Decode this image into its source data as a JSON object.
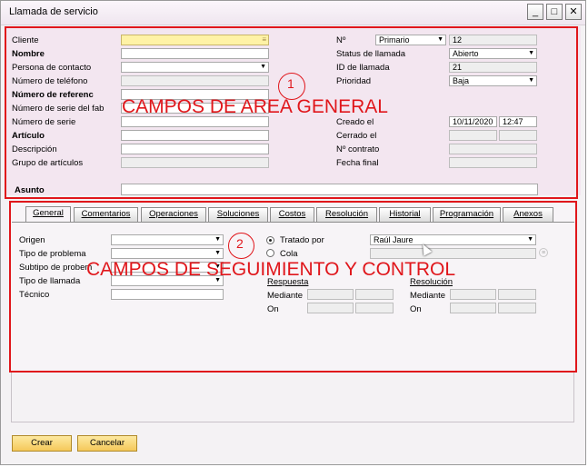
{
  "window": {
    "title": "Llamada de servicio",
    "minimize": "_",
    "maximize": "□",
    "close": "✕"
  },
  "general": {
    "left_labels": [
      "Cliente",
      "Nombre",
      "Persona de contacto",
      "Número de teléfono",
      "Número de referenc",
      "Número de serie del fab",
      "Número de serie",
      "Artículo",
      "Descripción",
      "Grupo de artículos"
    ],
    "right_labels": [
      "Nº",
      "Status de llamada",
      "ID de llamada",
      "Prioridad",
      "Creado el",
      "Cerrado el",
      "Nº contrato",
      "Fecha final"
    ],
    "numbering_series": "Primario",
    "number": "12",
    "status": "Abierto",
    "call_id": "21",
    "priority": "Baja",
    "created_date": "10/11/2020",
    "created_time": "12:47",
    "subject_label": "Asunto"
  },
  "annotations": {
    "one_number": "1",
    "one_text": "CAMPOS DE AREA GENERAL",
    "two_number": "2",
    "two_text": "CAMPOS DE SEGUIMIENTO Y CONTROL"
  },
  "tabs": [
    "General",
    "Comentarios",
    "Operaciones",
    "Soluciones",
    "Costos",
    "Resolución",
    "Historial",
    "Programación",
    "Anexos"
  ],
  "tab_general": {
    "left_labels": [
      "Origen",
      "Tipo de problema",
      "Subtipo de probem",
      "Tipo de llamada",
      "Técnico"
    ],
    "handled_by_label": "Tratado por",
    "handled_by_value": "Raúl Jaure",
    "queue_label": "Cola",
    "response_label": "Respuesta",
    "resolution_label": "Resolución",
    "via_label": "Mediante",
    "on_label": "On"
  },
  "buttons": {
    "create": "Crear",
    "cancel": "Cancelar"
  }
}
